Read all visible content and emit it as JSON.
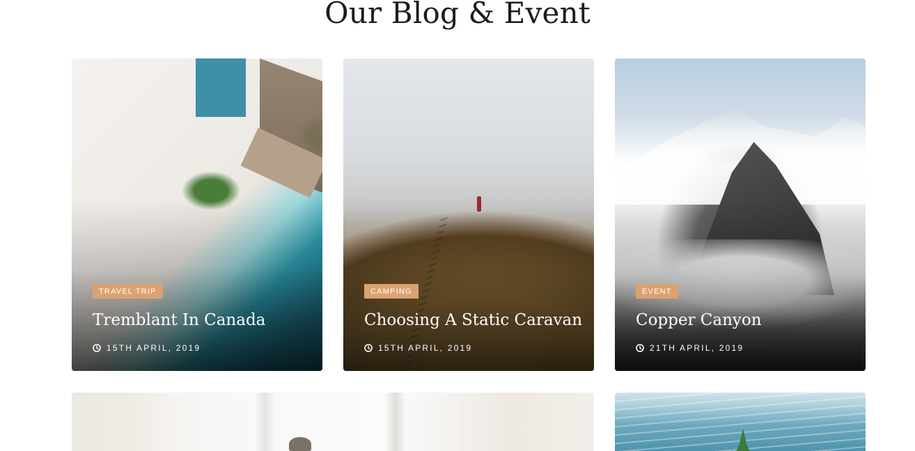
{
  "section": {
    "title": "Our Blog & Event"
  },
  "posts": [
    {
      "tag": "Travel Trip",
      "title": "Tremblant In Canada",
      "date": "15th April, 2019"
    },
    {
      "tag": "Camping",
      "title": "Choosing A Static Caravan",
      "date": "15th April, 2019"
    },
    {
      "tag": "Event",
      "title": "Copper Canyon",
      "date": "21th April, 2019"
    }
  ],
  "icons": {
    "date": "clock-icon"
  },
  "colors": {
    "tag_bg": "#dba26f",
    "title_text": "#1b1b1b"
  }
}
